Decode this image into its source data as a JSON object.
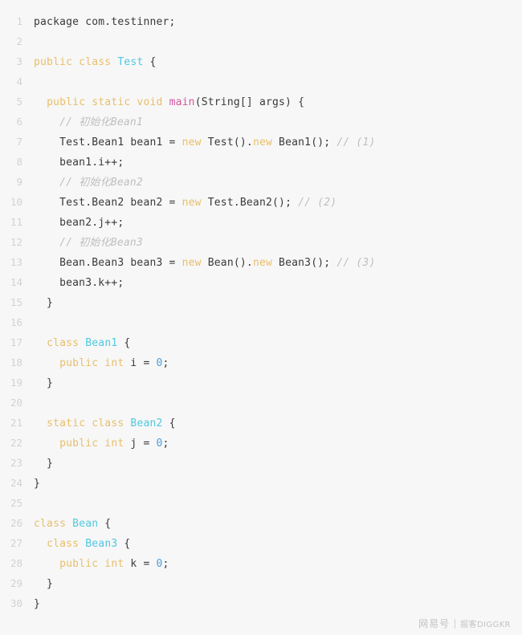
{
  "editor": {
    "language": "java",
    "background_color": "#f7f7f7",
    "line_number_color": "#d2d2d2",
    "default_text_color": "#3a3a3a",
    "total_lines": 30,
    "colors": {
      "keyword": "#e8bf6a",
      "type": "#4ec9e0",
      "number": "#4a9fe0",
      "function": "#d4569c",
      "comment": "#bfbfbf"
    },
    "lines": [
      {
        "n": "1",
        "tokens": [
          {
            "t": "package com.testinner;",
            "c": "plain"
          }
        ]
      },
      {
        "n": "2",
        "tokens": []
      },
      {
        "n": "3",
        "tokens": [
          {
            "t": "public class ",
            "c": "kw"
          },
          {
            "t": "Test",
            "c": "type"
          },
          {
            "t": " {",
            "c": "plain"
          }
        ]
      },
      {
        "n": "4",
        "tokens": []
      },
      {
        "n": "5",
        "tokens": [
          {
            "t": "  ",
            "c": "plain"
          },
          {
            "t": "public static void ",
            "c": "kw"
          },
          {
            "t": "main",
            "c": "fn"
          },
          {
            "t": "(String[] args) {",
            "c": "plain"
          }
        ]
      },
      {
        "n": "6",
        "tokens": [
          {
            "t": "    ",
            "c": "plain"
          },
          {
            "t": "// 初始化Bean1",
            "c": "comment"
          }
        ]
      },
      {
        "n": "7",
        "tokens": [
          {
            "t": "    Test.Bean1 bean1 = ",
            "c": "plain"
          },
          {
            "t": "new",
            "c": "kw"
          },
          {
            "t": " Test().",
            "c": "plain"
          },
          {
            "t": "new",
            "c": "kw"
          },
          {
            "t": " Bean1(); ",
            "c": "plain"
          },
          {
            "t": "// (1)",
            "c": "comment"
          }
        ]
      },
      {
        "n": "8",
        "tokens": [
          {
            "t": "    bean1.i++;",
            "c": "plain"
          }
        ]
      },
      {
        "n": "9",
        "tokens": [
          {
            "t": "    ",
            "c": "plain"
          },
          {
            "t": "// 初始化Bean2",
            "c": "comment"
          }
        ]
      },
      {
        "n": "10",
        "tokens": [
          {
            "t": "    Test.Bean2 bean2 = ",
            "c": "plain"
          },
          {
            "t": "new",
            "c": "kw"
          },
          {
            "t": " Test.Bean2(); ",
            "c": "plain"
          },
          {
            "t": "// (2)",
            "c": "comment"
          }
        ]
      },
      {
        "n": "11",
        "tokens": [
          {
            "t": "    bean2.j++;",
            "c": "plain"
          }
        ]
      },
      {
        "n": "12",
        "tokens": [
          {
            "t": "    ",
            "c": "plain"
          },
          {
            "t": "// 初始化Bean3",
            "c": "comment"
          }
        ]
      },
      {
        "n": "13",
        "tokens": [
          {
            "t": "    Bean.Bean3 bean3 = ",
            "c": "plain"
          },
          {
            "t": "new",
            "c": "kw"
          },
          {
            "t": " Bean().",
            "c": "plain"
          },
          {
            "t": "new",
            "c": "kw"
          },
          {
            "t": " Bean3(); ",
            "c": "plain"
          },
          {
            "t": "// (3)",
            "c": "comment"
          }
        ]
      },
      {
        "n": "14",
        "tokens": [
          {
            "t": "    bean3.k++;",
            "c": "plain"
          }
        ]
      },
      {
        "n": "15",
        "tokens": [
          {
            "t": "  }",
            "c": "plain"
          }
        ]
      },
      {
        "n": "16",
        "tokens": []
      },
      {
        "n": "17",
        "tokens": [
          {
            "t": "  ",
            "c": "plain"
          },
          {
            "t": "class ",
            "c": "kw"
          },
          {
            "t": "Bean1",
            "c": "type"
          },
          {
            "t": " {",
            "c": "plain"
          }
        ]
      },
      {
        "n": "18",
        "tokens": [
          {
            "t": "    ",
            "c": "plain"
          },
          {
            "t": "public int ",
            "c": "kw"
          },
          {
            "t": "i = ",
            "c": "plain"
          },
          {
            "t": "0",
            "c": "num"
          },
          {
            "t": ";",
            "c": "plain"
          }
        ]
      },
      {
        "n": "19",
        "tokens": [
          {
            "t": "  }",
            "c": "plain"
          }
        ]
      },
      {
        "n": "20",
        "tokens": []
      },
      {
        "n": "21",
        "tokens": [
          {
            "t": "  ",
            "c": "plain"
          },
          {
            "t": "static class ",
            "c": "kw"
          },
          {
            "t": "Bean2",
            "c": "type"
          },
          {
            "t": " {",
            "c": "plain"
          }
        ]
      },
      {
        "n": "22",
        "tokens": [
          {
            "t": "    ",
            "c": "plain"
          },
          {
            "t": "public int ",
            "c": "kw"
          },
          {
            "t": "j = ",
            "c": "plain"
          },
          {
            "t": "0",
            "c": "num"
          },
          {
            "t": ";",
            "c": "plain"
          }
        ]
      },
      {
        "n": "23",
        "tokens": [
          {
            "t": "  }",
            "c": "plain"
          }
        ]
      },
      {
        "n": "24",
        "tokens": [
          {
            "t": "}",
            "c": "plain"
          }
        ]
      },
      {
        "n": "25",
        "tokens": []
      },
      {
        "n": "26",
        "tokens": [
          {
            "t": "class ",
            "c": "kw"
          },
          {
            "t": "Bean",
            "c": "type"
          },
          {
            "t": " {",
            "c": "plain"
          }
        ]
      },
      {
        "n": "27",
        "tokens": [
          {
            "t": "  ",
            "c": "plain"
          },
          {
            "t": "class ",
            "c": "kw"
          },
          {
            "t": "Bean3",
            "c": "type"
          },
          {
            "t": " {",
            "c": "plain"
          }
        ]
      },
      {
        "n": "28",
        "tokens": [
          {
            "t": "    ",
            "c": "plain"
          },
          {
            "t": "public int ",
            "c": "kw"
          },
          {
            "t": "k = ",
            "c": "plain"
          },
          {
            "t": "0",
            "c": "num"
          },
          {
            "t": ";",
            "c": "plain"
          }
        ]
      },
      {
        "n": "29",
        "tokens": [
          {
            "t": "  }",
            "c": "plain"
          }
        ]
      },
      {
        "n": "30",
        "tokens": [
          {
            "t": "}",
            "c": "plain"
          }
        ]
      }
    ]
  },
  "watermark": {
    "brand": "网易号",
    "separator": "|",
    "site": "掘客DIGGKR"
  }
}
